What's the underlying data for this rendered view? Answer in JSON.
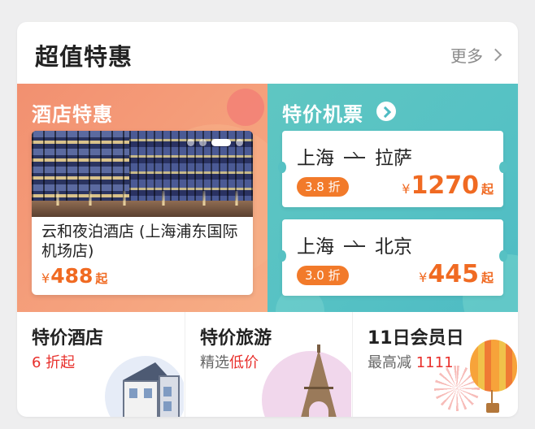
{
  "header": {
    "title": "超值特惠",
    "more_label": "更多"
  },
  "hotel_deals": {
    "title": "酒店特惠",
    "carousel_dots": 4,
    "carousel_active_index": 2,
    "card": {
      "name": "云和夜泊酒店 (上海浦东国际机场店)",
      "price_symbol": "¥",
      "price": "488",
      "price_suffix": "起"
    }
  },
  "flight_deals": {
    "title": "特价机票",
    "tickets": [
      {
        "from": "上海",
        "to": "拉萨",
        "discount": "3.8 折",
        "price_symbol": "¥",
        "price": "1270",
        "price_suffix": "起"
      },
      {
        "from": "上海",
        "to": "北京",
        "discount": "3.0 折",
        "price_symbol": "¥",
        "price": "445",
        "price_suffix": "起"
      }
    ]
  },
  "bottom_entries": [
    {
      "title": "特价酒店",
      "sub": "6 折起",
      "sub_prefix": "",
      "sub_highlight": "6 折起",
      "icon": "villa-illustration"
    },
    {
      "title": "特价旅游",
      "sub_prefix": "精选",
      "sub_highlight": "低价",
      "icon": "eiffel-tower-illustration"
    },
    {
      "title": "11日会员日",
      "sub_prefix": "最高减 ",
      "sub_highlight": "1111",
      "icon": "hot-air-balloon-illustration"
    }
  ],
  "colors": {
    "accent_orange": "#f06a22",
    "discount_badge": "#f27a2a",
    "highlight_red": "#e8302c",
    "hotel_panel": "#f29070",
    "flight_panel": "#55c1c4"
  }
}
